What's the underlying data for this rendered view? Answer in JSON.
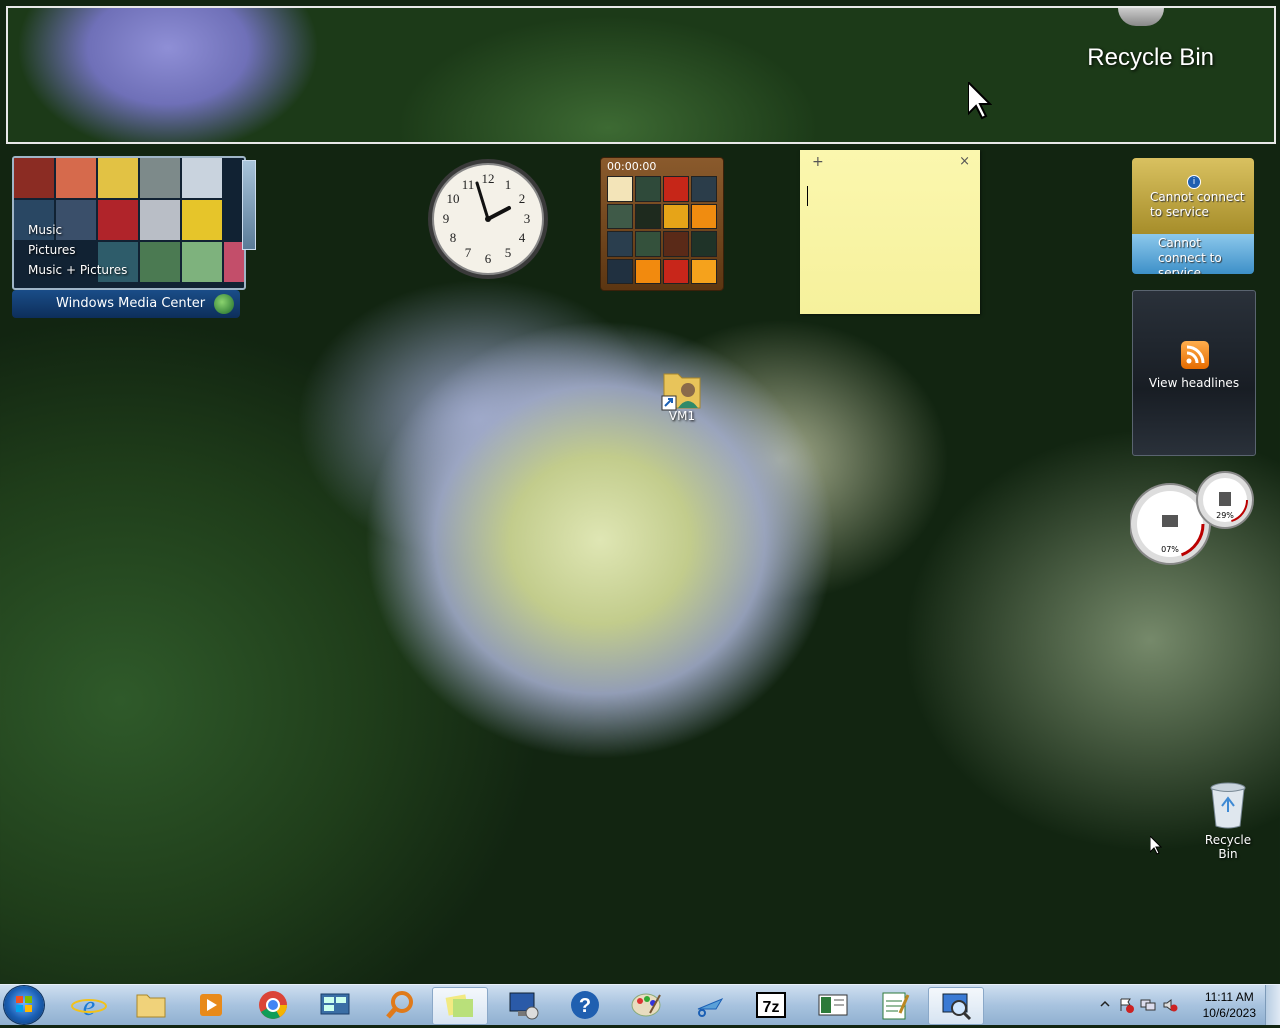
{
  "magnifier": {
    "label": "Recycle Bin"
  },
  "wmc": {
    "menu": [
      "Music",
      "Pictures",
      "Music + Pictures"
    ],
    "title": "Windows Media Center"
  },
  "puzzle": {
    "timer": "00:00:00"
  },
  "note": {
    "add": "+",
    "close": "×",
    "text": ""
  },
  "weather": {
    "msg1": "Cannot connect to service",
    "msg2": "Cannot connect to service"
  },
  "feed": {
    "label": "View headlines"
  },
  "meters": {
    "cpu": "07%",
    "memory": "29%"
  },
  "desktop": {
    "vm_label": "VM1",
    "recycle_label": "Recycle Bin"
  },
  "taskbar": {
    "apps": [
      "Internet Explorer",
      "Windows Explorer",
      "Windows Media Player",
      "Google Chrome",
      "Remote Desktop Connection Manager",
      "Search",
      "Sticky Notes",
      "Remote Desktop Connection",
      "Help and Support",
      "Paint",
      "Snipping Tool",
      "7-Zip",
      "Reader",
      "Notepad",
      "Magnifier"
    ],
    "time": "11:11 AM",
    "date": "10/6/2023"
  },
  "colors": {
    "taskbar": "#a8c3df",
    "note": "#f6f19c",
    "weather": "#c8ad45",
    "accent": "#1a5fb4"
  }
}
